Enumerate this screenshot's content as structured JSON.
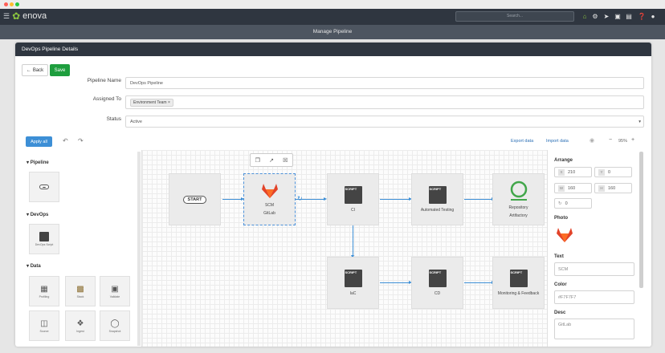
{
  "app": {
    "name": "enova",
    "search_placeholder": "Search...",
    "page_title": "Manage Pipeline"
  },
  "card": {
    "title": "DevOps Pipeline Details"
  },
  "actions": {
    "back": "Back",
    "save": "Save",
    "apply_all": "Apply all",
    "export": "Export data",
    "import": "Import data",
    "zoom": "95%",
    "zoom_minus": "−",
    "zoom_plus": "+"
  },
  "form": {
    "name_label": "Pipeline Name",
    "name_value": "DevOps Pipeline",
    "assigned_label": "Assigned To",
    "assigned_tag": "Environment Team",
    "status_label": "Status",
    "status_value": "Active"
  },
  "palette": {
    "groups": [
      {
        "label": "Pipeline",
        "items": [
          ""
        ]
      },
      {
        "label": "DevOps",
        "items": [
          "DevOps Script"
        ]
      },
      {
        "label": "Data",
        "items": [
          "Profiling",
          "Stack",
          "Validate",
          "Source",
          "Ingest",
          "Snapshot"
        ]
      }
    ]
  },
  "nodes": {
    "start": "START",
    "scm": "SCM",
    "scm_sub": "GitLab",
    "ci": "CI",
    "testing": "Automated Testing",
    "repo": "Repository",
    "repo_sub": "Artifactory",
    "iac": "IaC",
    "cd": "CD",
    "monitoring": "Monitoring & Feedback",
    "script_badge": "SCRIPT"
  },
  "properties": {
    "arrange": "Arrange",
    "x": "210",
    "y": "0",
    "w": "160",
    "h": "160",
    "rotate": "0",
    "photo": "Photo",
    "text_label": "Text",
    "text_value": "SCM",
    "color_label": "Color",
    "color_value": "#F7F7F7",
    "desc_label": "Desc",
    "desc_value": "GitLab",
    "keys": {
      "x": "X",
      "y": "Y",
      "w": "W",
      "h": "H"
    }
  },
  "colors": {
    "accent": "#3d8fd6",
    "save": "#1e9e3e",
    "nav": "#2f3640",
    "gitlab": "#e24329",
    "artifactory": "#41a64a",
    "leaf": "#8cc63f"
  }
}
